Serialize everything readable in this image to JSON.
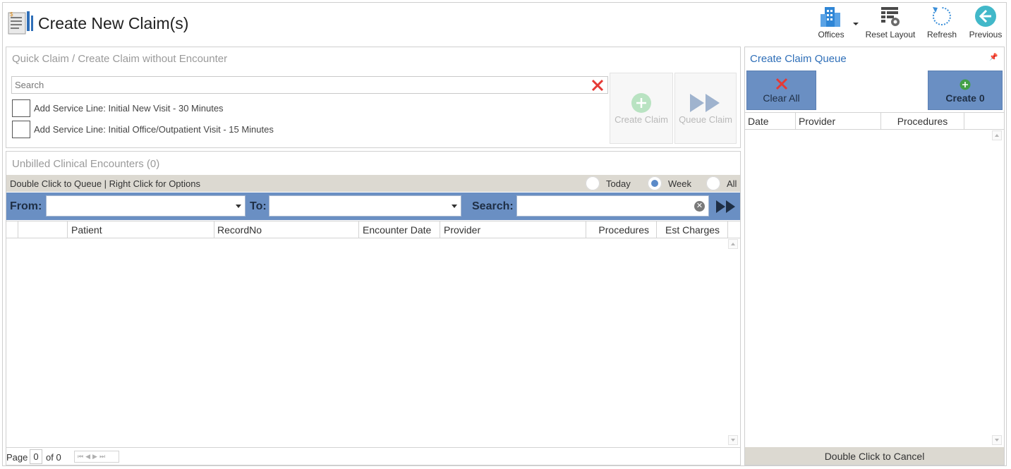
{
  "header": {
    "title": "Create New Claim(s)",
    "toolbar": {
      "offices_label": "Offices",
      "reset_layout_label": "Reset Layout",
      "refresh_label": "Refresh",
      "previous_label": "Previous"
    }
  },
  "quick_claim": {
    "title": "Quick Claim / Create Claim without Encounter",
    "search_placeholder": "Search",
    "service_lines": [
      {
        "label": "Add Service Line: Initial New Visit - 30 Minutes",
        "checked": false
      },
      {
        "label": "Add Service Line: Initial Office/Outpatient Visit - 15 Minutes",
        "checked": false
      }
    ],
    "create_claim_label": "Create Claim",
    "queue_claim_label": "Queue Claim"
  },
  "encounters": {
    "title": "Unbilled Clinical Encounters (0)",
    "hint": "Double Click to Queue | Right Click for Options",
    "range_options": [
      {
        "label": "Today",
        "selected": false
      },
      {
        "label": "Week",
        "selected": true
      },
      {
        "label": "All",
        "selected": false
      }
    ],
    "filters": {
      "from_label": "From:",
      "from_value": "",
      "to_label": "To:",
      "to_value": "",
      "search_label": "Search:",
      "search_value": ""
    },
    "columns": [
      "Patient",
      "RecordNo",
      "Encounter Date",
      "Provider",
      "Procedures",
      "Est Charges"
    ],
    "rows": [],
    "pager": {
      "page_label": "Page",
      "page_value": "0",
      "of_label": "of 0"
    }
  },
  "queue": {
    "title": "Create Claim Queue",
    "clear_all_label": "Clear All",
    "create_label": "Create 0",
    "columns": [
      "Date",
      "Provider",
      "Procedures"
    ],
    "rows": [],
    "footer": "Double Click to Cancel"
  },
  "colors": {
    "accent_blue": "#6a8fc3",
    "title_blue": "#2f6fb8",
    "options_bar": "#dcd9d1",
    "clear_red": "#e53935",
    "create_green": "#43a047"
  }
}
